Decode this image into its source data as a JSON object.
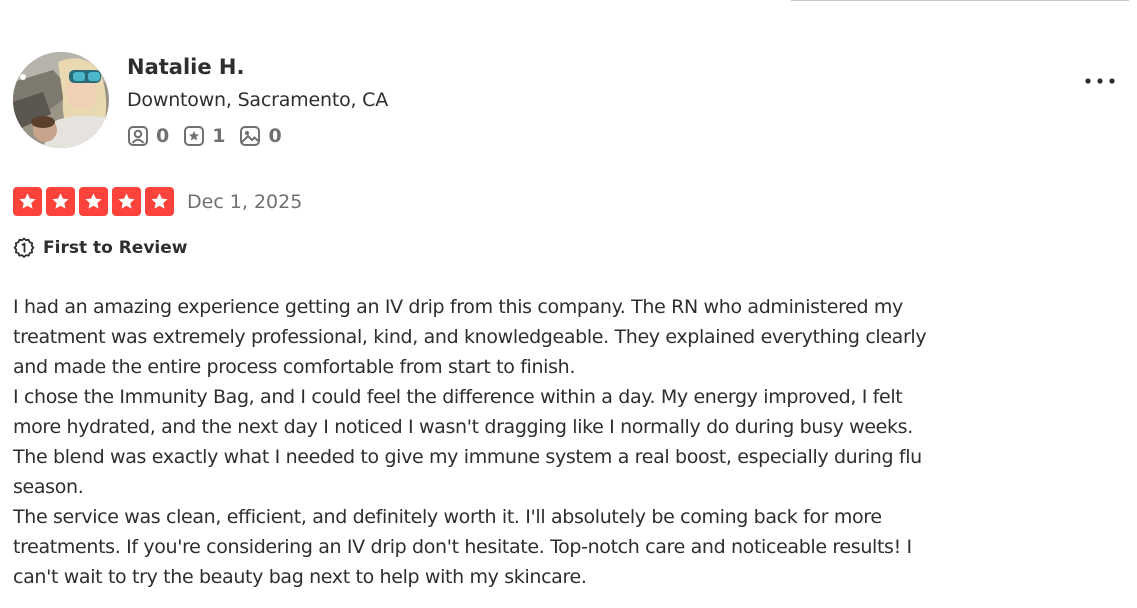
{
  "user": {
    "name": "Natalie H.",
    "location": "Downtown, Sacramento, CA",
    "stats": {
      "friends": "0",
      "reviews": "1",
      "photos": "0"
    }
  },
  "review": {
    "rating": 5,
    "date": "Dec 1, 2025",
    "badge": "First to Review",
    "lines": [
      "I had an amazing experience getting an IV drip from this company. The RN who administered my",
      "treatment was extremely professional, kind, and knowledgeable. They explained everything clearly",
      "and made the entire process comfortable from start to finish.",
      "I chose the Immunity Bag, and I could feel the difference within a day. My energy improved, I felt",
      "more hydrated, and the next day I noticed I wasn't dragging like I normally do during busy weeks.",
      "The blend was exactly what I needed to give my immune system a real boost, especially during flu",
      "season.",
      "The service was clean, efficient, and definitely worth it. I'll absolutely be coming back for more",
      "treatments. If you're considering an IV drip don't hesitate. Top-notch care and noticeable results! I",
      "can't wait to try the beauty bag next to help with my skincare."
    ]
  },
  "colors": {
    "star_red": "#fb433c",
    "text_primary": "#2d2e2f",
    "text_secondary": "#6e7072"
  },
  "icons": {
    "friends": "friends-icon",
    "reviews": "star-review-icon",
    "photos": "photo-icon",
    "more": "more-horizontal-icon",
    "badge": "first-to-review-icon"
  }
}
